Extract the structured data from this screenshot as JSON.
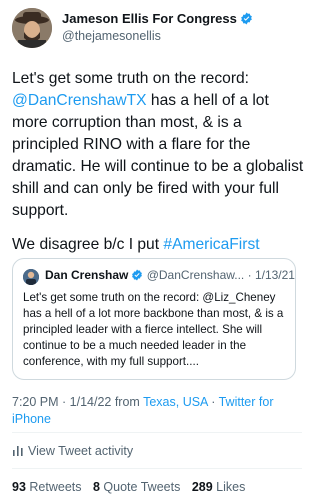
{
  "author": {
    "display_name": "Jameson Ellis For Congress",
    "handle": "@thejamesonellis"
  },
  "tweet": {
    "line1_before": "Let's get some truth on the record: ",
    "mention": "@DanCrenshawTX",
    "line1_after": " has a hell of a lot more corruption than most, & is a principled RINO with a flare for the dramatic. He will continue to be a globalist shill and can only be fired with your full support.",
    "line2_before": "We disagree b/c I put ",
    "hashtag": "#AmericaFirst"
  },
  "quoted": {
    "display_name": "Dan Crenshaw",
    "handle_truncated": "@DanCrenshaw...",
    "separator": " · ",
    "date": "1/13/21",
    "text": "Let's get some truth on the record: @Liz_Cheney has a hell of a lot more backbone than most, & is a principled leader with a fierce intellect. She will continue to be a much needed leader in the conference, with my full support...."
  },
  "meta": {
    "time_date": "7:20 PM · 1/14/22 from ",
    "location": "Texas, USA",
    "separator": " · ",
    "source": "Twitter for iPhone"
  },
  "activity": {
    "label": "View Tweet activity"
  },
  "stats": {
    "retweets_count": "93",
    "retweets_label": "Retweets",
    "quotes_count": "8",
    "quotes_label": "Quote Tweets",
    "likes_count": "289",
    "likes_label": "Likes"
  },
  "colors": {
    "link": "#1d9bf0",
    "secondary_text": "#536471",
    "primary_text": "#0f1419",
    "border": "#cfd9de"
  }
}
